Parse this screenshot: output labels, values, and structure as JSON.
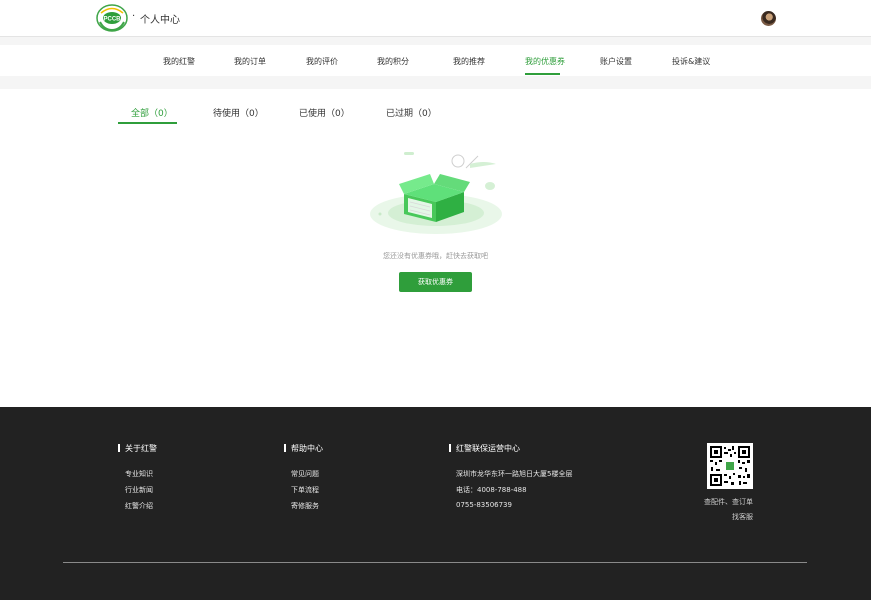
{
  "header": {
    "brand_dot": "·",
    "title": "个人中心",
    "logo_text": "PCCB"
  },
  "nav": {
    "items": [
      "我的红警",
      "我的订单",
      "我的评价",
      "我的积分",
      "我的推荐",
      "我的优惠券",
      "账户设置",
      "投诉&建议"
    ],
    "active_index": 5
  },
  "tabs": {
    "items": [
      "全部（0）",
      "待使用（0）",
      "已使用（0）",
      "已过期（0）"
    ],
    "active_index": 0
  },
  "empty_state": {
    "message": "您还没有优惠券哦，赶快去获取吧",
    "button": "获取优惠券"
  },
  "footer": {
    "about": {
      "title": "关于红警",
      "links": [
        "专业知识",
        "行业新闻",
        "红警介绍"
      ]
    },
    "help": {
      "title": "帮助中心",
      "links": [
        "常见问题",
        "下单流程",
        "寄修服务"
      ]
    },
    "ops": {
      "title": "红警联保运营中心",
      "lines": [
        "深圳市龙华东环一路旭日大厦5楼全层",
        "电话：4008-788-488",
        "0755-83506739"
      ]
    },
    "qr_caption_1": "查配件、查订单",
    "qr_caption_2": "找客服"
  },
  "colors": {
    "accent": "#2f9e3b",
    "footer_bg": "#222222"
  }
}
